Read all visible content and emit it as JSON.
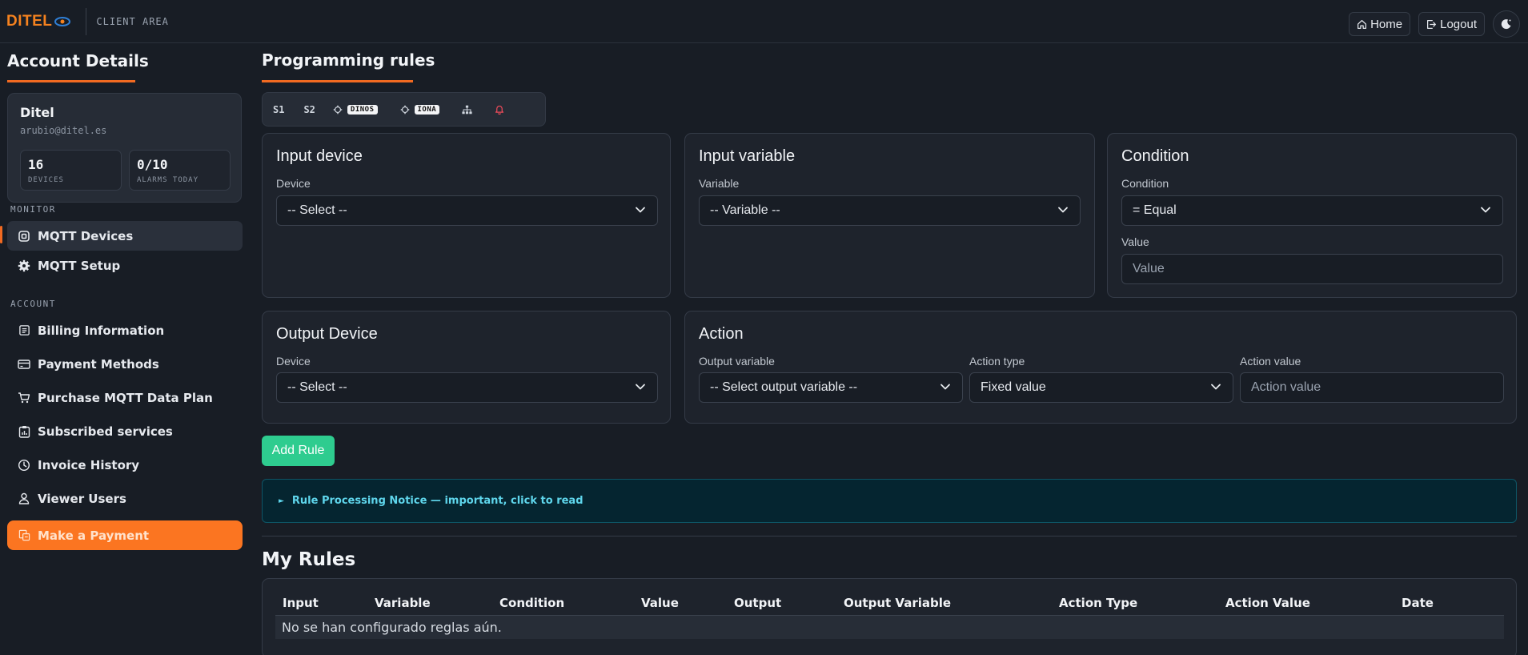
{
  "topbar": {
    "logo": "DITEL",
    "client_area": "CLIENT AREA",
    "home": "Home",
    "logout": "Logout"
  },
  "sidebar": {
    "title": "Account Details",
    "account": {
      "name": "Ditel",
      "email": "arubio@ditel.es",
      "devices_value": "16",
      "devices_label": "DEVICES",
      "alarms_value": "0/10",
      "alarms_label": "ALARMS TODAY"
    },
    "monitor_heading": "MONITOR",
    "monitor_items": [
      {
        "label": "MQTT Devices",
        "icon": "chip-icon",
        "active": true
      },
      {
        "label": "MQTT Setup",
        "icon": "gear-icon",
        "active": false
      }
    ],
    "account_heading": "ACCOUNT",
    "account_items": [
      {
        "label": "Billing Information",
        "icon": "document-icon"
      },
      {
        "label": "Payment Methods",
        "icon": "credit-card-icon"
      },
      {
        "label": "Purchase MQTT Data Plan",
        "icon": "cart-icon"
      },
      {
        "label": "Subscribed services",
        "icon": "clipboard-chart-icon"
      },
      {
        "label": "Invoice History",
        "icon": "clock-icon"
      },
      {
        "label": "Viewer Users",
        "icon": "user-icon"
      }
    ],
    "pay_button": "Make a Payment"
  },
  "main": {
    "title": "Programming rules",
    "toolbar": {
      "s1": "S1",
      "s2": "S2",
      "badge1": "DINOS",
      "badge2": "IONA"
    },
    "input_device": {
      "title": "Input device",
      "label": "Device",
      "value": "-- Select --"
    },
    "input_variable": {
      "title": "Input variable",
      "label": "Variable",
      "value": "-- Variable --"
    },
    "condition": {
      "title": "Condition",
      "label": "Condition",
      "value": "= Equal",
      "value_label": "Value",
      "value_placeholder": "Value"
    },
    "output_device": {
      "title": "Output Device",
      "label": "Device",
      "value": "-- Select --"
    },
    "action": {
      "title": "Action",
      "output_label": "Output variable",
      "output_value": "-- Select output variable --",
      "type_label": "Action type",
      "type_value": "Fixed value",
      "value_label": "Action value",
      "value_placeholder": "Action value"
    },
    "add_rule": "Add Rule",
    "notice": "Rule Processing Notice — important, click to read",
    "notice_marker": "►",
    "my_rules": {
      "title": "My Rules",
      "columns": [
        "Input",
        "Variable",
        "Condition",
        "Value",
        "Output",
        "Output Variable",
        "Action Type",
        "Action Value",
        "Date"
      ],
      "empty": "No se han configurado reglas aún."
    }
  },
  "colors": {
    "accent": "#f26a21",
    "pay_button": "#fb7521",
    "add_button": "#2ecc8f",
    "notice_text": "#5fd6ec",
    "background": "#181d25"
  }
}
